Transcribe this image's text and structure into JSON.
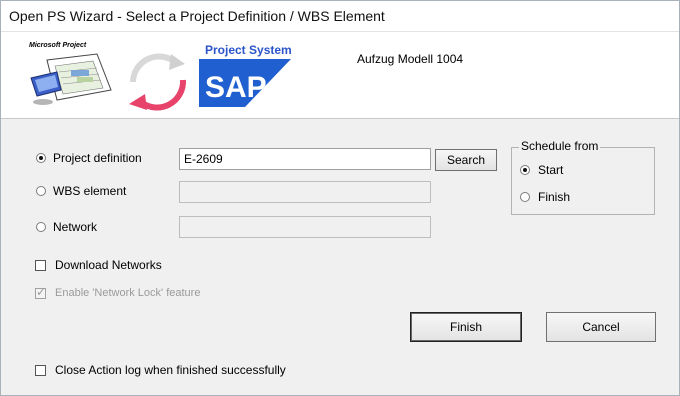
{
  "window": {
    "title": "Open PS Wizard - Select a Project Definition / WBS Element"
  },
  "header": {
    "ms_logo_text": "Microsoft Project",
    "ps_logo_text": "Project System",
    "sap_logo_text": "SAP",
    "project_name": "Aufzug Modell 1004"
  },
  "selection": {
    "project_definition": {
      "label": "Project definition",
      "value": "E-2609",
      "selected": true
    },
    "wbs_element": {
      "label": "WBS element",
      "value": "",
      "selected": false
    },
    "network": {
      "label": "Network",
      "value": "",
      "selected": false
    }
  },
  "buttons": {
    "search": "Search",
    "finish": "Finish",
    "cancel": "Cancel"
  },
  "schedule": {
    "title": "Schedule from",
    "start": "Start",
    "finish": "Finish",
    "selected": "Start"
  },
  "options": {
    "download_networks": {
      "label": "Download Networks",
      "checked": false
    },
    "network_lock": {
      "label": "Enable 'Network Lock' feature",
      "checked": true,
      "disabled": true
    },
    "close_action_log": {
      "label": "Close Action log when finished successfully",
      "checked": false
    }
  },
  "colors": {
    "sap_blue": "#1f5fd0",
    "ps_blue": "#2a55c9",
    "arrow_red": "#e8436a"
  }
}
